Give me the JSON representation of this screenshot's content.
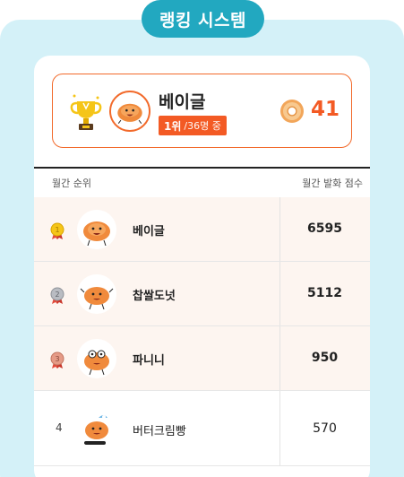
{
  "header": {
    "title": "랭킹 시스템"
  },
  "me": {
    "name": "베이글",
    "rank_label": "1위",
    "rank_total": "/36명 중",
    "points": "41"
  },
  "table": {
    "col_left": "월간 순위",
    "col_right": "월간 발화 점수",
    "rows": [
      {
        "rank": "1",
        "name": "베이글",
        "score": "6595",
        "medal": "gold"
      },
      {
        "rank": "2",
        "name": "찹쌀도넛",
        "score": "5112",
        "medal": "silver"
      },
      {
        "rank": "3",
        "name": "파니니",
        "score": "950",
        "medal": "bronze"
      },
      {
        "rank": "4",
        "name": "버터크림빵",
        "score": "570",
        "medal": ""
      }
    ]
  },
  "colors": {
    "accent": "#f35a24",
    "header": "#22a8c0",
    "bg": "#d4f1f8",
    "top_row": "#fdf5f0"
  }
}
